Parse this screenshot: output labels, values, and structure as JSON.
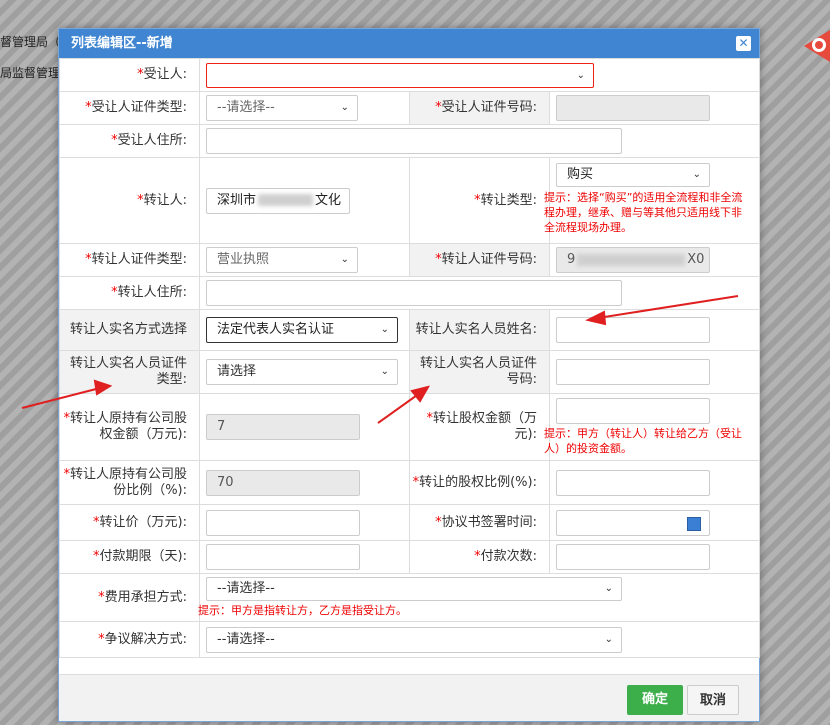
{
  "background": {
    "text1": "督管理局（",
    "text2": "局监督管理"
  },
  "dialog": {
    "title": "列表编辑区--新增",
    "close_icon": "close-icon"
  },
  "form": {
    "assignee": {
      "label": "受让人:",
      "value": ""
    },
    "assignee_id_type": {
      "label": "受让人证件类型:",
      "value": "--请选择--"
    },
    "assignee_id_no": {
      "label": "受让人证件号码:",
      "value": ""
    },
    "assignee_address": {
      "label": "受让人住所:",
      "value": ""
    },
    "assignor": {
      "label": "转让人:",
      "value": "深圳市",
      "value_tail": "文化"
    },
    "transfer_type": {
      "label": "转让类型:",
      "value": "购买",
      "tip": "提示：选择“购买”的适用全流程和非全流程办理，继承、赠与等其他只适用线下非全流程现场办理。"
    },
    "assignor_id_type": {
      "label": "转让人证件类型:",
      "value": "营业执照"
    },
    "assignor_id_no": {
      "label": "转让人证件号码:",
      "value_head": "9",
      "value_tail": "X0"
    },
    "assignor_address": {
      "label": "转让人住所:",
      "value": ""
    },
    "realname_method": {
      "label": "转让人实名方式选择",
      "value": "法定代表人实名认证"
    },
    "realname_person_name": {
      "label": "转让人实名人员姓名:",
      "value": ""
    },
    "realname_person_id_type": {
      "label": "转让人实名人员证件类型:",
      "value": "请选择"
    },
    "realname_person_id_no": {
      "label": "转让人实名人员证件号码:",
      "value": ""
    },
    "original_equity_amount": {
      "label": "转让人原持有公司股权金额（万元):",
      "value": "7"
    },
    "transfer_equity_amount": {
      "label": "转让股权金额（万元):",
      "value": "",
      "tip": "提示：甲方（转让人）转让给乙方（受让人）的投资金额。"
    },
    "original_share_ratio": {
      "label": "转让人原持有公司股份比例（%):",
      "value": "70"
    },
    "transfer_share_ratio": {
      "label": "转让的股权比例(%):",
      "value": ""
    },
    "transfer_price": {
      "label": "转让价（万元):",
      "value": ""
    },
    "sign_date": {
      "label": "协议书签署时间:",
      "value": "",
      "icon": "calendar-icon"
    },
    "payment_term": {
      "label": "付款期限（天):",
      "value": ""
    },
    "payment_count": {
      "label": "付款次数:",
      "value": ""
    },
    "cost_bearing": {
      "label": "费用承担方式:",
      "value": "--请选择--",
      "tip": "提示：甲方是指转让方，乙方是指受让方。"
    },
    "dispute_resolution": {
      "label": "争议解决方式:",
      "value": "--请选择--"
    }
  },
  "buttons": {
    "confirm": "确定",
    "cancel": "取消"
  },
  "colors": {
    "titlebar": "#3f85d1",
    "required": "#ee0000",
    "confirm": "#3cae4a",
    "annotation_arrow": "#e02020"
  }
}
